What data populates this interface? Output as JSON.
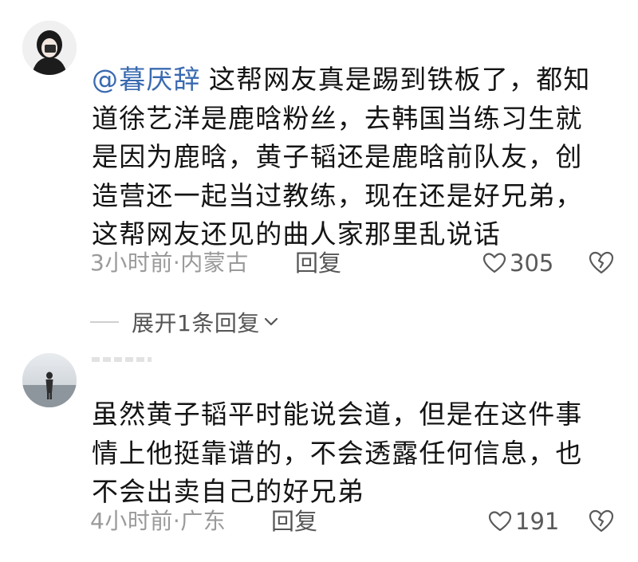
{
  "comments": [
    {
      "mention": "@暮厌辞",
      "lines": [
        "这帮网友真是踢到铁板了，都知",
        "道徐艺洋是鹿晗粉丝，去韩国当练习生就",
        "是因为鹿晗，黄子韬还是鹿晗前队友，创",
        "造营还一起当过教练，现在还是好兄弟，",
        "这帮网友还见的曲人家那里乱说话"
      ],
      "meta": "3小时前·内蒙古",
      "reply_label": "回复",
      "likes": "305",
      "expand_label": "展开1条回复"
    },
    {
      "lines": [
        "虽然黄子韬平时能说会道，但是在这件事",
        "情上他挺靠谱的，不会透露任何信息，也",
        "不会出卖自己的好兄弟"
      ],
      "meta": "4小时前·广东",
      "reply_label": "回复",
      "likes": "191"
    }
  ],
  "icons": {
    "like": "heart-outline-icon",
    "dislike": "broken-heart-icon",
    "expand": "chevron-down-icon"
  },
  "colors": {
    "mention": "#3a6ab0",
    "meta": "#9a9a9a",
    "text": "#141414"
  }
}
